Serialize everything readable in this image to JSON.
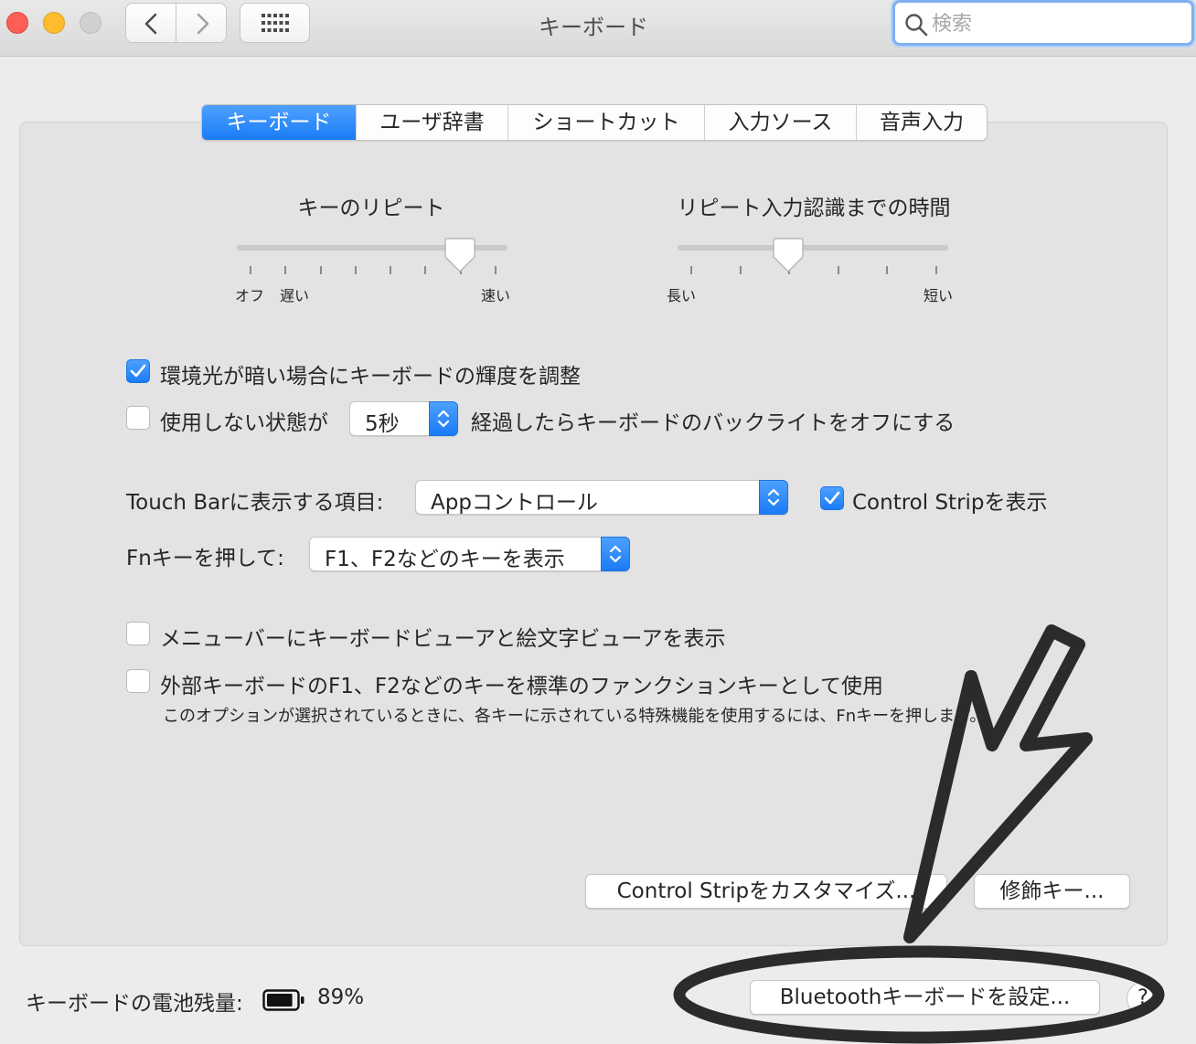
{
  "window": {
    "title": "キーボード"
  },
  "search": {
    "placeholder": "検索"
  },
  "tabs": [
    {
      "label": "キーボード",
      "active": true
    },
    {
      "label": "ユーザ辞書",
      "active": false
    },
    {
      "label": "ショートカット",
      "active": false
    },
    {
      "label": "入力ソース",
      "active": false
    },
    {
      "label": "音声入力",
      "active": false
    }
  ],
  "key_repeat": {
    "title": "キーのリピート",
    "labels": {
      "off": "オフ",
      "slow": "遅い",
      "fast": "速い"
    },
    "ticks": 8,
    "value_step": 6
  },
  "repeat_delay": {
    "title": "リピート入力認識までの時間",
    "labels": {
      "long": "長い",
      "short": "短い"
    },
    "ticks": 6,
    "value_fraction": 0.4
  },
  "options": {
    "auto_brightness": {
      "label": "環境光が暗い場合にキーボードの輝度を調整",
      "checked": true
    },
    "backlight_off": {
      "label_before": "使用しない状態が",
      "value": "5秒",
      "label_after": "経過したらキーボードのバックライトをオフにする",
      "checked": false
    },
    "touchbar": {
      "label": "Touch Barに表示する項目:",
      "value": "Appコントロール",
      "control_strip": {
        "label": "Control Stripを表示",
        "checked": true
      }
    },
    "fn_key": {
      "label": "Fnキーを押して:",
      "value": "F1、F2などのキーを表示"
    },
    "menu_viewer": {
      "label": "メニューバーにキーボードビューアと絵文字ビューアを表示",
      "checked": false
    },
    "standard_fn": {
      "label": "外部キーボードのF1、F2などのキーを標準のファンクションキーとして使用",
      "note": "このオプションが選択されているときに、各キーに示されている特殊機能を使用するには、Fnキーを押します。",
      "checked": false
    }
  },
  "buttons": {
    "customize_control_strip": "Control Stripをカスタマイズ...",
    "modifier_keys": "修飾キー...",
    "bluetooth_keyboard": "Bluetoothキーボードを設定...",
    "help": "?"
  },
  "battery": {
    "label": "キーボードの電池残量:",
    "percent": "89%",
    "level": 0.89
  },
  "colors": {
    "accent": "#1a7cf5",
    "annotation": "#2b2b2b"
  }
}
